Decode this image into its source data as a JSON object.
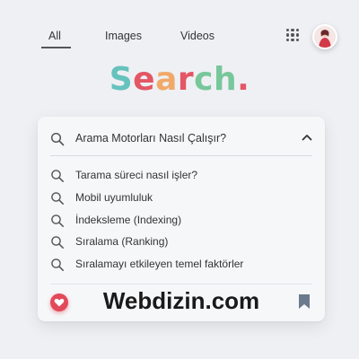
{
  "nav": {
    "tabs": [
      {
        "label": "All"
      },
      {
        "label": "Images"
      },
      {
        "label": "Videos"
      }
    ],
    "active_tab": "All"
  },
  "logo": {
    "letters": [
      {
        "char": "S",
        "color": "#66c2bd"
      },
      {
        "char": "e",
        "color": "#e45664"
      },
      {
        "char": "a",
        "color": "#f1a96a"
      },
      {
        "char": "r",
        "color": "#e45664"
      },
      {
        "char": "c",
        "color": "#77c79a"
      },
      {
        "char": "h",
        "color": "#77c79a"
      },
      {
        "char": ".",
        "color": "#e45664"
      }
    ]
  },
  "search": {
    "query": "Arama Motorları Nasıl Çalışır?",
    "suggestions": [
      "Tarama süreci nasıl işler?",
      "Mobil uyumluluk",
      "İndeksleme (Indexing)",
      "Sıralama (Ranking)",
      "Sıralamayı etkileyen temel faktörler"
    ]
  },
  "footer": {
    "brand": "Webdizin.com"
  },
  "colors": {
    "accent_red": "#e24a5a",
    "bookmark": "#6b7a8c",
    "icon_gray": "#555555"
  }
}
